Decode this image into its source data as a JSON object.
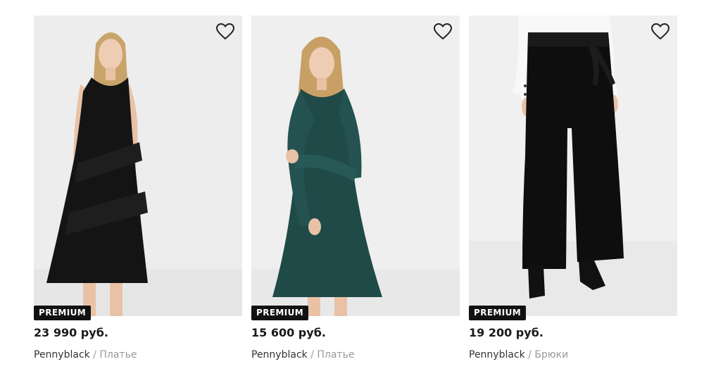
{
  "products": [
    {
      "badge": "PREMIUM",
      "price": "23 990 руб.",
      "brand": "Pennyblack",
      "separator": " / ",
      "category": "Платье",
      "icon": "heart-outline-icon",
      "image_subject": "woman in black sleeveless lace dress"
    },
    {
      "badge": "PREMIUM",
      "price": "15 600 руб.",
      "brand": "Pennyblack",
      "separator": " / ",
      "category": "Платье",
      "icon": "heart-outline-icon",
      "image_subject": "woman in dark green long-sleeve dress"
    },
    {
      "badge": "PREMIUM",
      "price": "19 200 руб.",
      "brand": "Pennyblack",
      "separator": " / ",
      "category": "Брюки",
      "icon": "heart-outline-icon",
      "image_subject": "black velvet wide-leg trousers"
    }
  ],
  "colors": {
    "photo_background": "#ececec",
    "badge_background": "#111111",
    "badge_text": "#ffffff",
    "price_text": "#1a1a1a",
    "category_text": "#9a9a9a",
    "dress_black": "#141414",
    "dress_green": "#1f4a48",
    "trousers_black": "#0e0e0e"
  }
}
